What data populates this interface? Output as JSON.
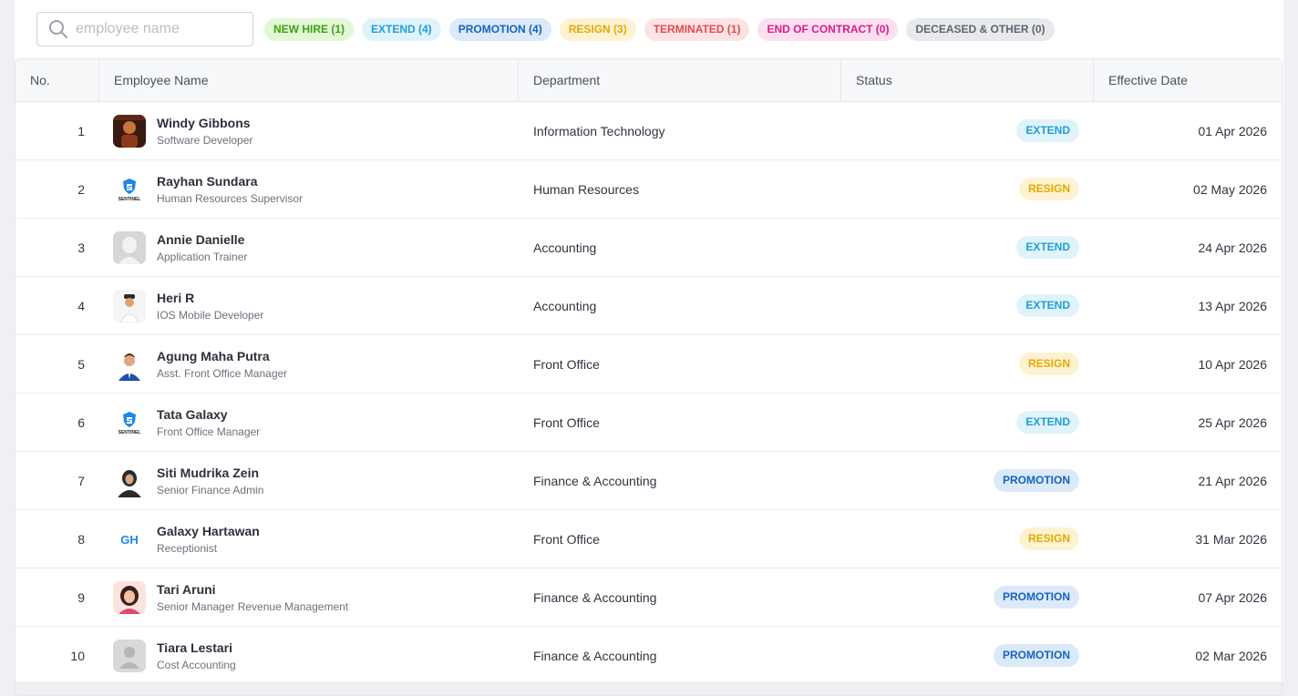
{
  "search": {
    "placeholder": "employee name"
  },
  "filters": [
    {
      "label": "NEW HIRE (1)",
      "fg": "#3aa311",
      "bg": "#e3f7d6"
    },
    {
      "label": "EXTEND (4)",
      "fg": "#1f9fd6",
      "bg": "#e0f3fb"
    },
    {
      "label": "PROMOTION (4)",
      "fg": "#1565c0",
      "bg": "#dce9f8"
    },
    {
      "label": "RESIGN (3)",
      "fg": "#e6a800",
      "bg": "#fdf3d2"
    },
    {
      "label": "TERMINATED (1)",
      "fg": "#e5484d",
      "bg": "#fde4e4"
    },
    {
      "label": "END OF CONTRACT (0)",
      "fg": "#d81b8c",
      "bg": "#fce0ef"
    },
    {
      "label": "DECEASED & OTHER (0)",
      "fg": "#5f6570",
      "bg": "#e8e9ec"
    }
  ],
  "columns": {
    "no": "No.",
    "name": "Employee Name",
    "department": "Department",
    "status": "Status",
    "date": "Effective Date"
  },
  "status_styles": {
    "EXTEND": {
      "fg": "#1f9fd6",
      "bg": "#e0f3fb"
    },
    "RESIGN": {
      "fg": "#e6a800",
      "bg": "#fdf3d2"
    },
    "PROMOTION": {
      "fg": "#1565c0",
      "bg": "#dce9f8"
    }
  },
  "rows": [
    {
      "no": "1",
      "name": "Windy Gibbons",
      "title": "Software Developer",
      "department": "Information Technology",
      "status": "EXTEND",
      "date": "01 Apr 2026",
      "avatar": "photo-dark"
    },
    {
      "no": "2",
      "name": "Rayhan Sundara",
      "title": "Human Resources Supervisor",
      "department": "Human Resources",
      "status": "RESIGN",
      "date": "02 May 2026",
      "avatar": "sentinel-logo",
      "avatar_text": "SENTINEL"
    },
    {
      "no": "3",
      "name": "Annie Danielle",
      "title": "Application Trainer",
      "department": "Accounting",
      "status": "EXTEND",
      "date": "24 Apr 2026",
      "avatar": "placeholder-female"
    },
    {
      "no": "4",
      "name": "Heri R",
      "title": "IOS Mobile Developer",
      "department": "Accounting",
      "status": "EXTEND",
      "date": "13 Apr 2026",
      "avatar": "photo-man-cap"
    },
    {
      "no": "5",
      "name": "Agung Maha Putra",
      "title": "Asst. Front Office Manager",
      "department": "Front Office",
      "status": "RESIGN",
      "date": "10 Apr 2026",
      "avatar": "photo-man-suit"
    },
    {
      "no": "6",
      "name": "Tata Galaxy",
      "title": "Front Office Manager",
      "department": "Front Office",
      "status": "EXTEND",
      "date": "25 Apr 2026",
      "avatar": "sentinel-logo",
      "avatar_text": "SENTINEL"
    },
    {
      "no": "7",
      "name": "Siti Mudrika Zein",
      "title": "Senior Finance Admin",
      "department": "Finance & Accounting",
      "status": "PROMOTION",
      "date": "21 Apr 2026",
      "avatar": "photo-woman-hijab"
    },
    {
      "no": "8",
      "name": "Galaxy Hartawan",
      "title": "Receptionist",
      "department": "Front Office",
      "status": "RESIGN",
      "date": "31 Mar 2026",
      "avatar": "initials",
      "avatar_text": "GH"
    },
    {
      "no": "9",
      "name": "Tari Aruni",
      "title": "Senior Manager Revenue Management",
      "department": "Finance & Accounting",
      "status": "PROMOTION",
      "date": "07 Apr 2026",
      "avatar": "illustration-woman"
    },
    {
      "no": "10",
      "name": "Tiara Lestari",
      "title": "Cost Accounting",
      "department": "Finance & Accounting",
      "status": "PROMOTION",
      "date": "02 Mar 2026",
      "avatar": "placeholder-generic"
    }
  ]
}
